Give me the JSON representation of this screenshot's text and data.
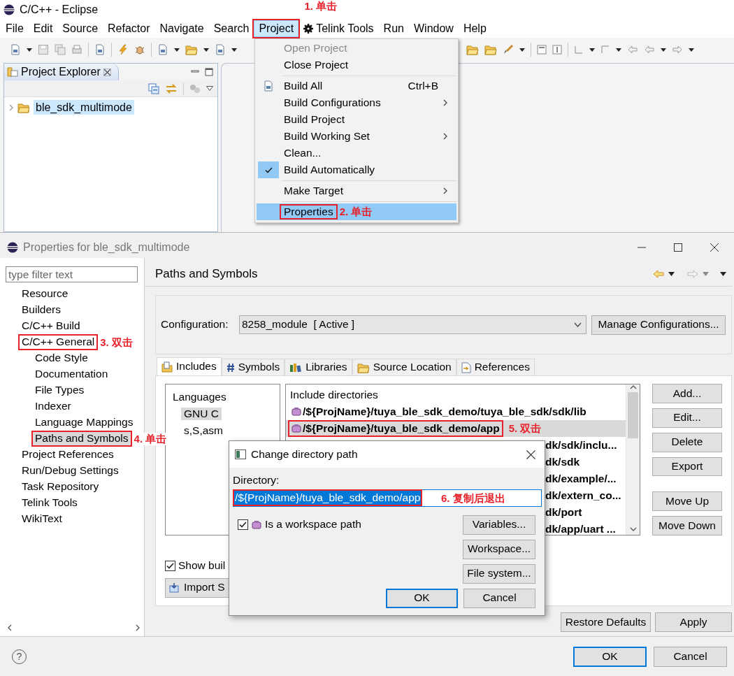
{
  "eclipse_window": {
    "title": "C/C++ - Eclipse",
    "menu": [
      {
        "label": "File",
        "selected": false
      },
      {
        "label": "Edit",
        "selected": false
      },
      {
        "label": "Source",
        "selected": false
      },
      {
        "label": "Refactor",
        "selected": false
      },
      {
        "label": "Navigate",
        "selected": false
      },
      {
        "label": "Search",
        "selected": false
      },
      {
        "label": "Project",
        "selected": true,
        "annotation": "1. 单击"
      },
      {
        "label": "Telink Tools",
        "selected": false,
        "kind": "icon"
      },
      {
        "label": "Run",
        "selected": false
      },
      {
        "label": "Window",
        "selected": false
      },
      {
        "label": "Help",
        "selected": false
      }
    ],
    "project_explorer": {
      "title": "Project Explorer",
      "items": [
        {
          "label": "ble_sdk_multimode",
          "selected": true,
          "expanded": false
        }
      ]
    }
  },
  "project_menu": {
    "items": [
      {
        "kind": "item",
        "label": "Open Project",
        "disabled": true
      },
      {
        "kind": "item",
        "label": "Close Project",
        "disabled": false
      },
      {
        "kind": "separator"
      },
      {
        "kind": "item",
        "label": "Build All",
        "disabled": false,
        "shortcut": "Ctrl+B",
        "icon": true
      },
      {
        "kind": "item",
        "label": "Build Configurations",
        "disabled": false,
        "submenu": true
      },
      {
        "kind": "item",
        "label": "Build Project",
        "disabled": false
      },
      {
        "kind": "item",
        "label": "Build Working Set",
        "disabled": false,
        "submenu": true
      },
      {
        "kind": "item",
        "label": "Clean...",
        "disabled": false
      },
      {
        "kind": "item",
        "label": "Build Automatically",
        "disabled": false,
        "checked": true
      },
      {
        "kind": "separator"
      },
      {
        "kind": "item",
        "label": "Make Target",
        "disabled": false,
        "submenu": true
      },
      {
        "kind": "separator"
      },
      {
        "kind": "item",
        "label": "Properties",
        "disabled": false,
        "selected": true,
        "annotation": "2. 单击"
      }
    ]
  },
  "properties_dialog": {
    "title": "Properties for ble_sdk_multimode",
    "filter": {
      "placeholder": "type filter text"
    },
    "tree": [
      {
        "label": "Resource",
        "selected": false
      },
      {
        "label": "Builders",
        "selected": false
      },
      {
        "label": "C/C++ Build",
        "selected": false
      },
      {
        "label": "C/C++ General",
        "selected": false,
        "annotation": "3. 双击",
        "children": [
          {
            "label": "Code Style",
            "selected": false
          },
          {
            "label": "Documentation",
            "selected": false
          },
          {
            "label": "File Types",
            "selected": false
          },
          {
            "label": "Indexer",
            "selected": false
          },
          {
            "label": "Language Mappings",
            "selected": false
          },
          {
            "label": "Paths and Symbols",
            "selected": true,
            "annotation": "4. 单击"
          }
        ]
      },
      {
        "label": "Project References",
        "selected": false
      },
      {
        "label": "Run/Debug Settings",
        "selected": false
      },
      {
        "label": "Task Repository",
        "selected": false
      },
      {
        "label": "Telink Tools",
        "selected": false
      },
      {
        "label": "WikiText",
        "selected": false
      }
    ],
    "page_title": "Paths and Symbols",
    "configuration": {
      "label": "Configuration:",
      "value": "8258_module  [ Active ]"
    },
    "manage_button": "Manage Configurations...",
    "tabs": [
      {
        "label": "Includes",
        "selected": true
      },
      {
        "label": "Symbols",
        "selected": false
      },
      {
        "label": "Libraries",
        "selected": false
      },
      {
        "label": "Source Location",
        "selected": false
      },
      {
        "label": "References",
        "selected": false
      }
    ],
    "languages": {
      "header": "Languages",
      "items": [
        {
          "label": "GNU C",
          "selected": true
        },
        {
          "label": "s,S,asm",
          "selected": false
        }
      ]
    },
    "include_directories": {
      "header": "Include directories",
      "rows": [
        {
          "kind": "full",
          "text": "/${ProjName}/tuya_ble_sdk_demo/tuya_ble_sdk/sdk/lib",
          "selected": false
        },
        {
          "kind": "full",
          "text": "/${ProjName}/tuya_ble_sdk_demo/app",
          "selected": true,
          "annotation": "5. 双击"
        },
        {
          "kind": "partial",
          "text": "dk/sdk/inclu...",
          "selected": false
        },
        {
          "kind": "partial",
          "text": "dk/sdk",
          "selected": false
        },
        {
          "kind": "partial",
          "text": "dk/example/...",
          "selected": false
        },
        {
          "kind": "partial",
          "text": "dk/extern_co...",
          "selected": false
        },
        {
          "kind": "partial",
          "text": "dk/port",
          "selected": false
        },
        {
          "kind": "partial",
          "text": "dk/app/uart ...",
          "selected": false
        }
      ]
    },
    "side_button_groups": [
      [
        "Add...",
        "Edit...",
        "Delete",
        "Export"
      ],
      [
        "Move Up",
        "Move Down"
      ]
    ],
    "show_builtin": {
      "label": "Show buil",
      "checked": true
    },
    "import_button": "Import S",
    "restore_button": "Restore Defaults",
    "apply_button": "Apply",
    "help_symbol": "?",
    "buttons": [
      {
        "label": "OK",
        "default": true
      },
      {
        "label": "Cancel",
        "default": false
      }
    ]
  },
  "change_directory_dialog": {
    "title": "Change directory path",
    "directory_label": "Directory:",
    "directory_value": "/${ProjName}/tuya_ble_sdk_demo/app",
    "annotation": "6. 复制后退出",
    "workspace_path": {
      "label": "Is a workspace path",
      "checked": true
    },
    "side_buttons": [
      "Variables...",
      "Workspace...",
      "File system..."
    ],
    "buttons": [
      {
        "label": "OK",
        "default": true
      },
      {
        "label": "Cancel",
        "default": false
      }
    ]
  }
}
